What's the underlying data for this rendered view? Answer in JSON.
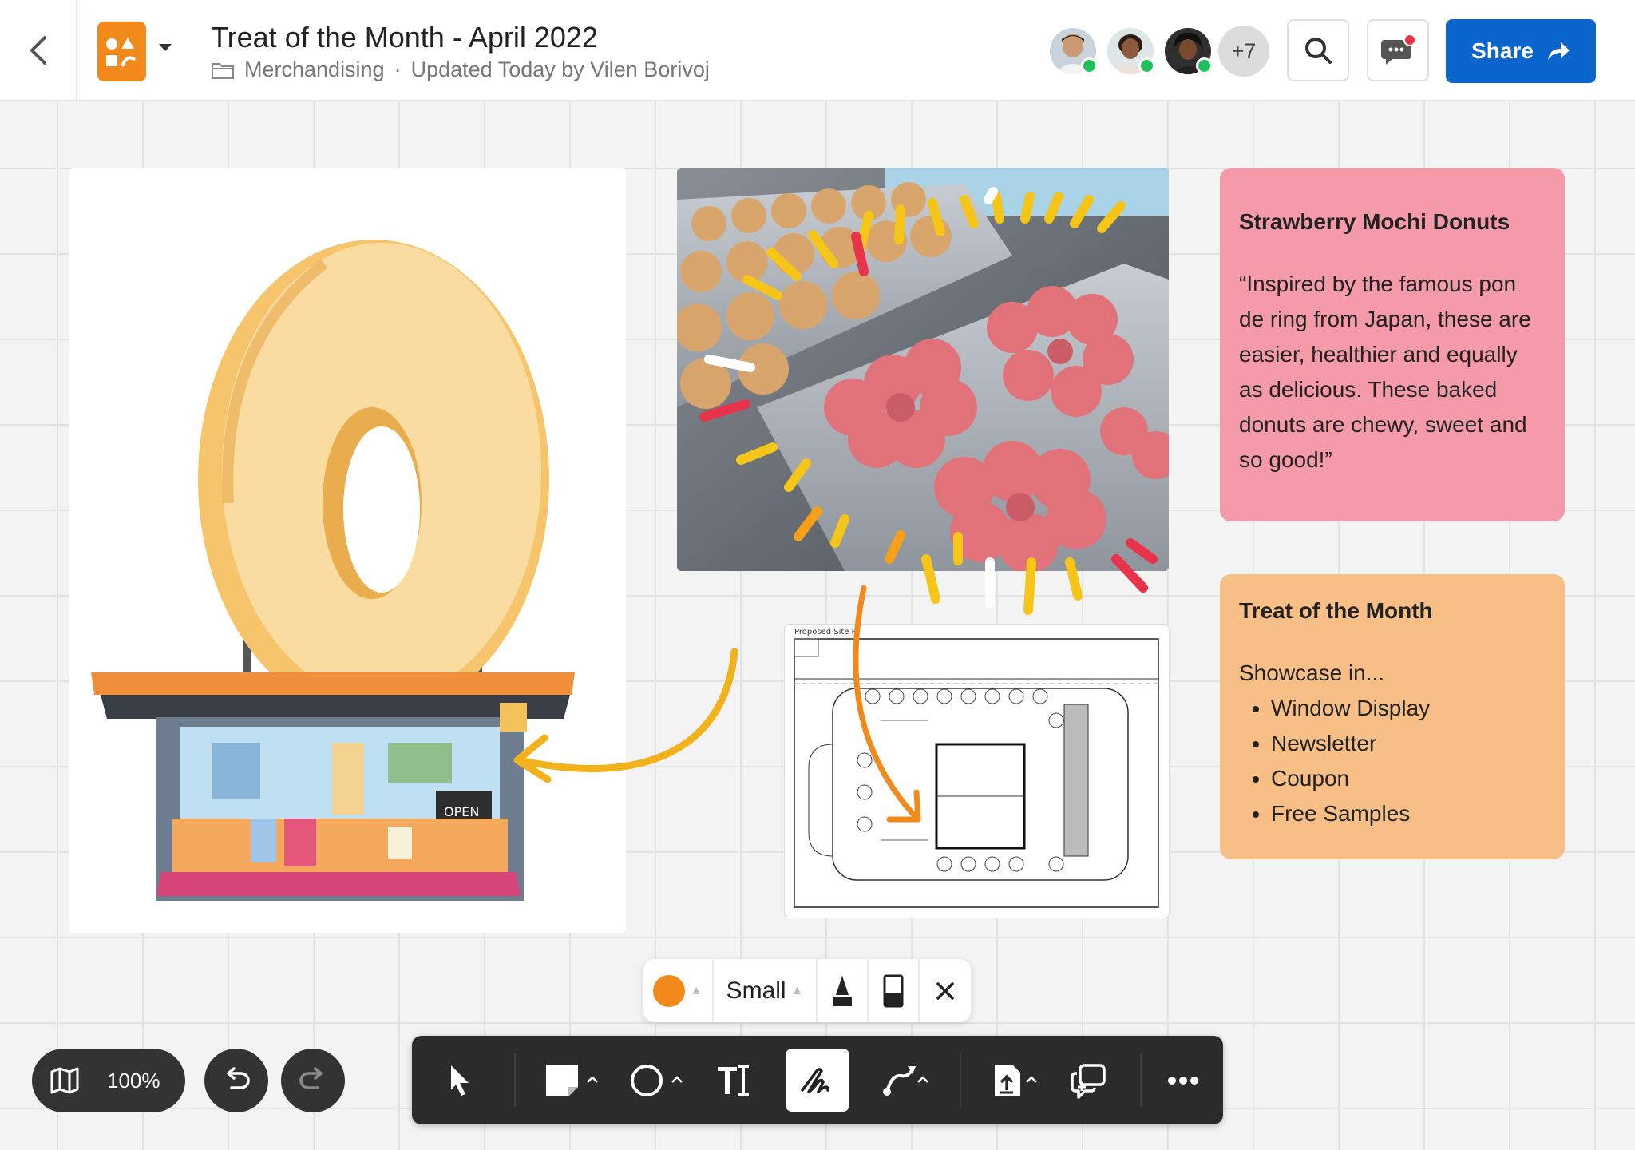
{
  "header": {
    "title": "Treat of the Month - April 2022",
    "folder": "Merchandising",
    "separator": "·",
    "updated": "Updated Today by Vilen Borivoj",
    "collaborators_more": "+7",
    "share_label": "Share",
    "icons": [
      "back-chevron-icon",
      "document-icon",
      "folder-icon",
      "search-icon",
      "chat-icon",
      "share-arrow-icon"
    ]
  },
  "notes": {
    "strawberry": {
      "title": "Strawberry Mochi Donuts",
      "body": "“Inspired by the famous pon de ring from Japan, these are easier, healthier and equally as delicious. These baked donuts are chewy, sweet and so good!”"
    },
    "treat": {
      "title": "Treat of the Month",
      "intro": "Showcase in...",
      "items": [
        "Window Display",
        "Newsletter",
        "Coupon",
        "Free Samples"
      ]
    }
  },
  "pen_options": {
    "color": "#f28a1b",
    "size_label": "Small"
  },
  "zoom": {
    "value": "100%"
  },
  "colors": {
    "share": "#0a66cc",
    "note_pink": "#f49aa8",
    "note_orange": "#f7be86",
    "toolbar": "#2b2b2b",
    "accent_orange": "#f28a1b",
    "presence_green": "#1fbf5a",
    "notification_red": "#e8334a"
  },
  "toolbar": {
    "active_tool": "pen",
    "tools": [
      "select",
      "sticky-note",
      "shape",
      "text",
      "pen",
      "connector",
      "upload",
      "comment",
      "more"
    ]
  },
  "canvas": {
    "shop_sign": "OPEN",
    "plan_caption": "Proposed Site Pl"
  }
}
